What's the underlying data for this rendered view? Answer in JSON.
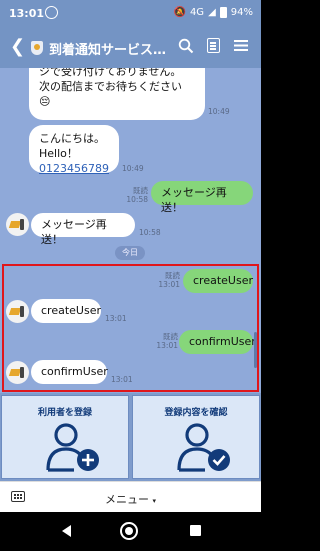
{
  "status_bar": {
    "time": "13:01",
    "network": "4G",
    "battery": "94%"
  },
  "header": {
    "title": "到着通知サービス_..."
  },
  "messages": {
    "partial_1": "ジで受け付けておりません。",
    "partial_2": "次の配信までお待ちください",
    "partial_emoji": "😔",
    "partial_time": "10:49",
    "hello_1": "こんにちは。",
    "hello_2": "Hello！",
    "hello_link": "0123456789",
    "hello_time": "10:49",
    "resend_me": "メッセージ再送！",
    "resend_me_read": "既読",
    "resend_me_time": "10:58",
    "resend_bot": "メッセージ再送！",
    "resend_bot_time": "10:58",
    "date_divider": "今日",
    "create_me": "createUser",
    "create_me_read": "既読",
    "create_me_time": "13:01",
    "create_bot": "createUser",
    "create_bot_time": "13:01",
    "confirm_me": "confirmUser",
    "confirm_me_read": "既読",
    "confirm_me_time": "13:01",
    "confirm_bot": "confirmUser",
    "confirm_bot_time": "13:01"
  },
  "rich_menu": {
    "left_label": "利用者を登録",
    "right_label": "登録内容を確認"
  },
  "bottom_bar": {
    "menu_label": "メニュー",
    "menu_caret": "▾"
  },
  "colors": {
    "header": "#7494c4",
    "chat_bg": "#8fa9d9",
    "my_bubble": "#86d67a",
    "highlight": "#e0161b",
    "rich_menu_icon": "#123b7a"
  }
}
